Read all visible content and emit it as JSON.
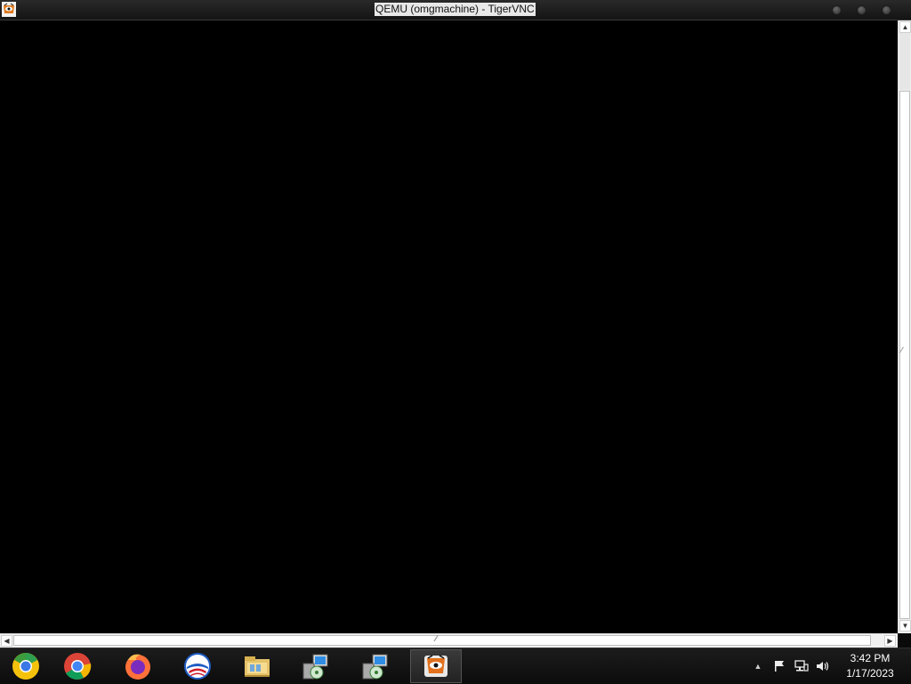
{
  "window": {
    "title": "QEMU (omgmachine) - TigerVNC"
  },
  "taskbar": {
    "apps": [
      {
        "name": "chrome-canary-icon"
      },
      {
        "name": "chrome-icon"
      },
      {
        "name": "firefox-icon"
      },
      {
        "name": "opera-icon"
      },
      {
        "name": "file-explorer-icon"
      },
      {
        "name": "setup-installer-icon"
      },
      {
        "name": "setup-installer-icon"
      },
      {
        "name": "tigervnc-icon",
        "active": true
      }
    ],
    "tray": {
      "icons": [
        "show-hidden-icons-icon",
        "action-center-flag-icon",
        "network-icon",
        "volume-icon"
      ]
    },
    "clock": {
      "time": "3:42 PM",
      "date": "1/17/2023"
    }
  }
}
